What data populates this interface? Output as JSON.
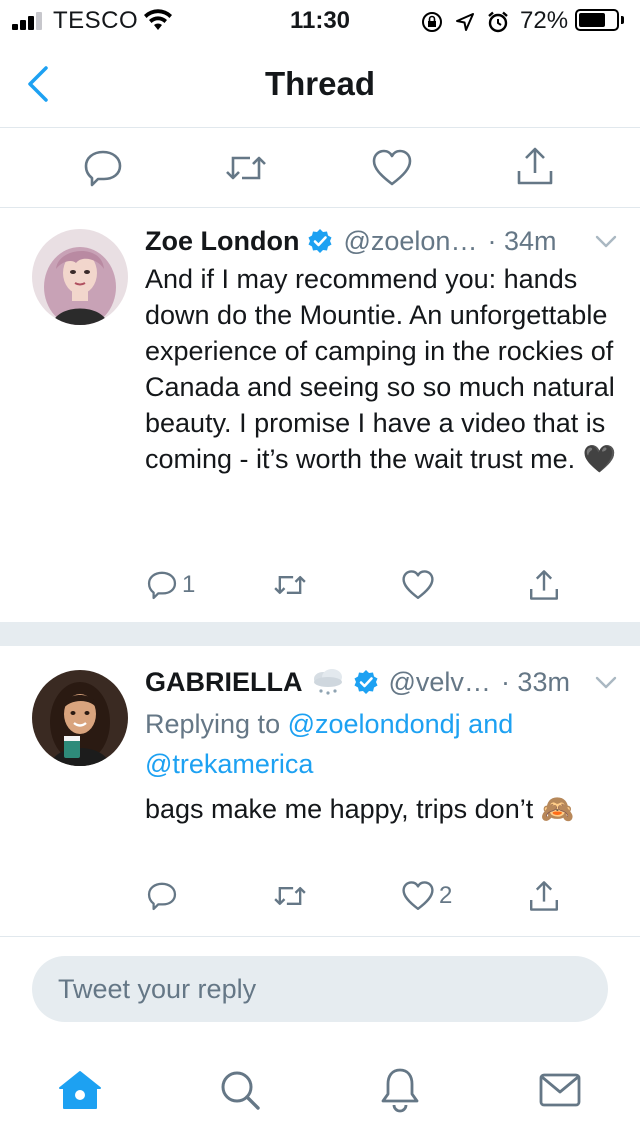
{
  "status_bar": {
    "carrier": "TESCO",
    "time": "11:30",
    "battery_percent": "72%",
    "battery_level": 0.72,
    "icons": [
      "signal-icon",
      "wifi-icon",
      "orientation-lock-icon",
      "location-icon",
      "alarm-icon",
      "battery-icon"
    ]
  },
  "header": {
    "title": "Thread",
    "back_icon": "chevron-left-icon"
  },
  "colors": {
    "accent": "#1da1f2",
    "text_primary": "#14171a",
    "text_secondary": "#657786",
    "separator": "#e6ecf0",
    "verified": "#1da1f2"
  },
  "top_actions": {
    "icons": [
      "reply-icon",
      "retweet-icon",
      "like-icon",
      "share-icon"
    ]
  },
  "tweets": [
    {
      "display_name": "Zoe London",
      "verified": true,
      "handle": "@zoelon…",
      "time": "· 34m",
      "text": "And if I may recommend you: hands down do the Mountie. An unforgettable experience of camping in the rockies of Canada and seeing so so much natural beauty. I promise I have a video that is coming - it’s worth the wait trust me. 🖤",
      "actions": {
        "reply_count": "1",
        "retweet_count": "",
        "like_count": "",
        "share": ""
      }
    },
    {
      "display_name": "GABRIELLA",
      "name_emoji": "🌨",
      "verified": true,
      "handle": "@velv…",
      "time": "· 33m",
      "replying_to_prefix": "Replying to",
      "replying_to_user1": "@zoelondondj",
      "replying_to_joiner": "and",
      "replying_to_user2": "@trekamerica",
      "text": "bags make me happy, trips don’t 🙈",
      "actions": {
        "reply_count": "",
        "retweet_count": "",
        "like_count": "2",
        "share": ""
      }
    }
  ],
  "reply_box": {
    "placeholder": "Tweet your reply"
  },
  "tabbar": {
    "tabs": [
      "home-icon",
      "search-icon",
      "notifications-icon",
      "messages-icon"
    ],
    "active": "home-icon"
  }
}
